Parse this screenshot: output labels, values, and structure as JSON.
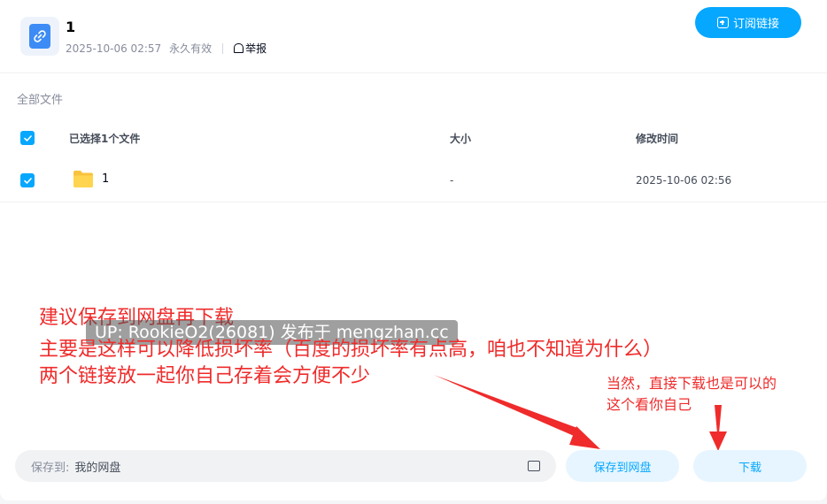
{
  "share": {
    "title": "1",
    "date": "2025-10-06 02:57",
    "validity": "永久有效",
    "report_label": "举报",
    "subscribe_label": "订阅链接"
  },
  "files": {
    "section_label": "全部文件",
    "columns": {
      "name": "已选择1个文件",
      "size": "大小",
      "modified": "修改时间"
    },
    "rows": [
      {
        "name": "1",
        "size": "-",
        "modified": "2025-10-06 02:56",
        "selected": true
      }
    ]
  },
  "annotations": {
    "main": [
      "建议保存到网盘再下载",
      "主要是这样可以降低损坏率（百度的损坏率有点高，咱也不知道为什么）",
      "两个链接放一起你自己存着会方便不少"
    ],
    "side": [
      "当然，直接下载也是可以的",
      "这个看你自己"
    ],
    "watermark": "UP: RookieO2(26081) 发布于 mengzhan.cc",
    "color": "#ef2b2b"
  },
  "footer": {
    "save_to_prefix": "保存到:",
    "save_to_path": "我的网盘",
    "save_button": "保存到网盘",
    "download_button": "下载"
  },
  "colors": {
    "accent": "#06a7ff",
    "accent_light": "#e6f5ff"
  }
}
